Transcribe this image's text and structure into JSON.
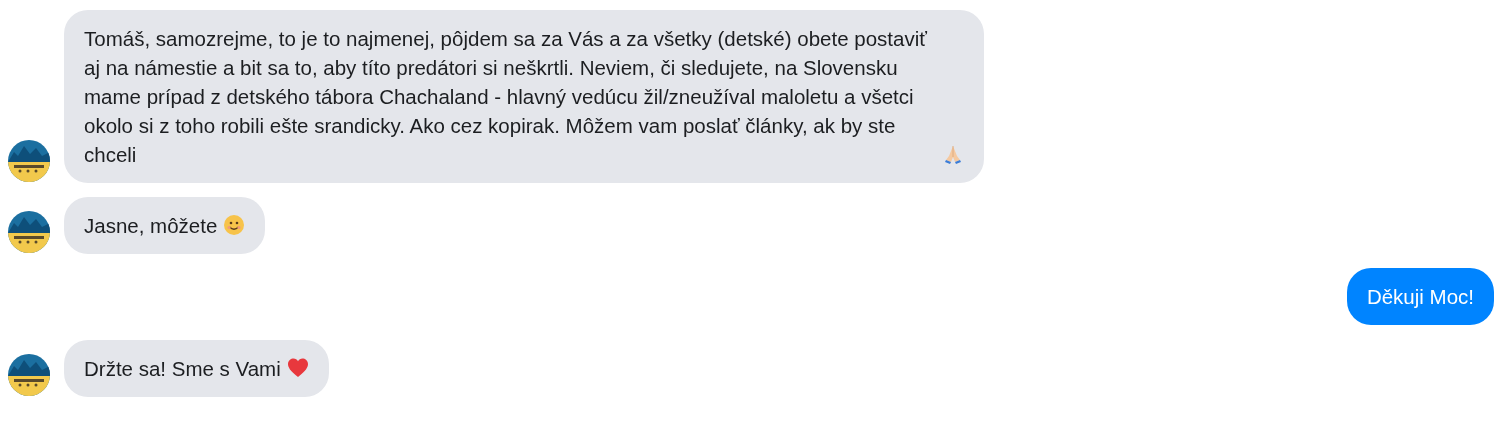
{
  "messages": [
    {
      "kind": "incoming",
      "text": "Tomáš, samozrejme, to je to najmenej, pôjdem sa za Vás a za všetky (detské) obete postaviť aj na námestie a bit sa to, aby títo predátori si neškrtli. Neviem, či sledujete, na Slovensku mame prípad z detského tábora Chachaland - hlavný vedúcu žil/zneužíval maloletu a všetci okolo si z toho robili ešte srandicky. Ako cez kopirak. Môžem vam poslať články, ak by ste chceli"
    },
    {
      "kind": "incoming",
      "text": "Jasne, môžete"
    },
    {
      "kind": "outgoing",
      "text": "Děkuji Moc!"
    },
    {
      "kind": "incoming",
      "text": "Držte sa! Sme s Vami"
    }
  ]
}
